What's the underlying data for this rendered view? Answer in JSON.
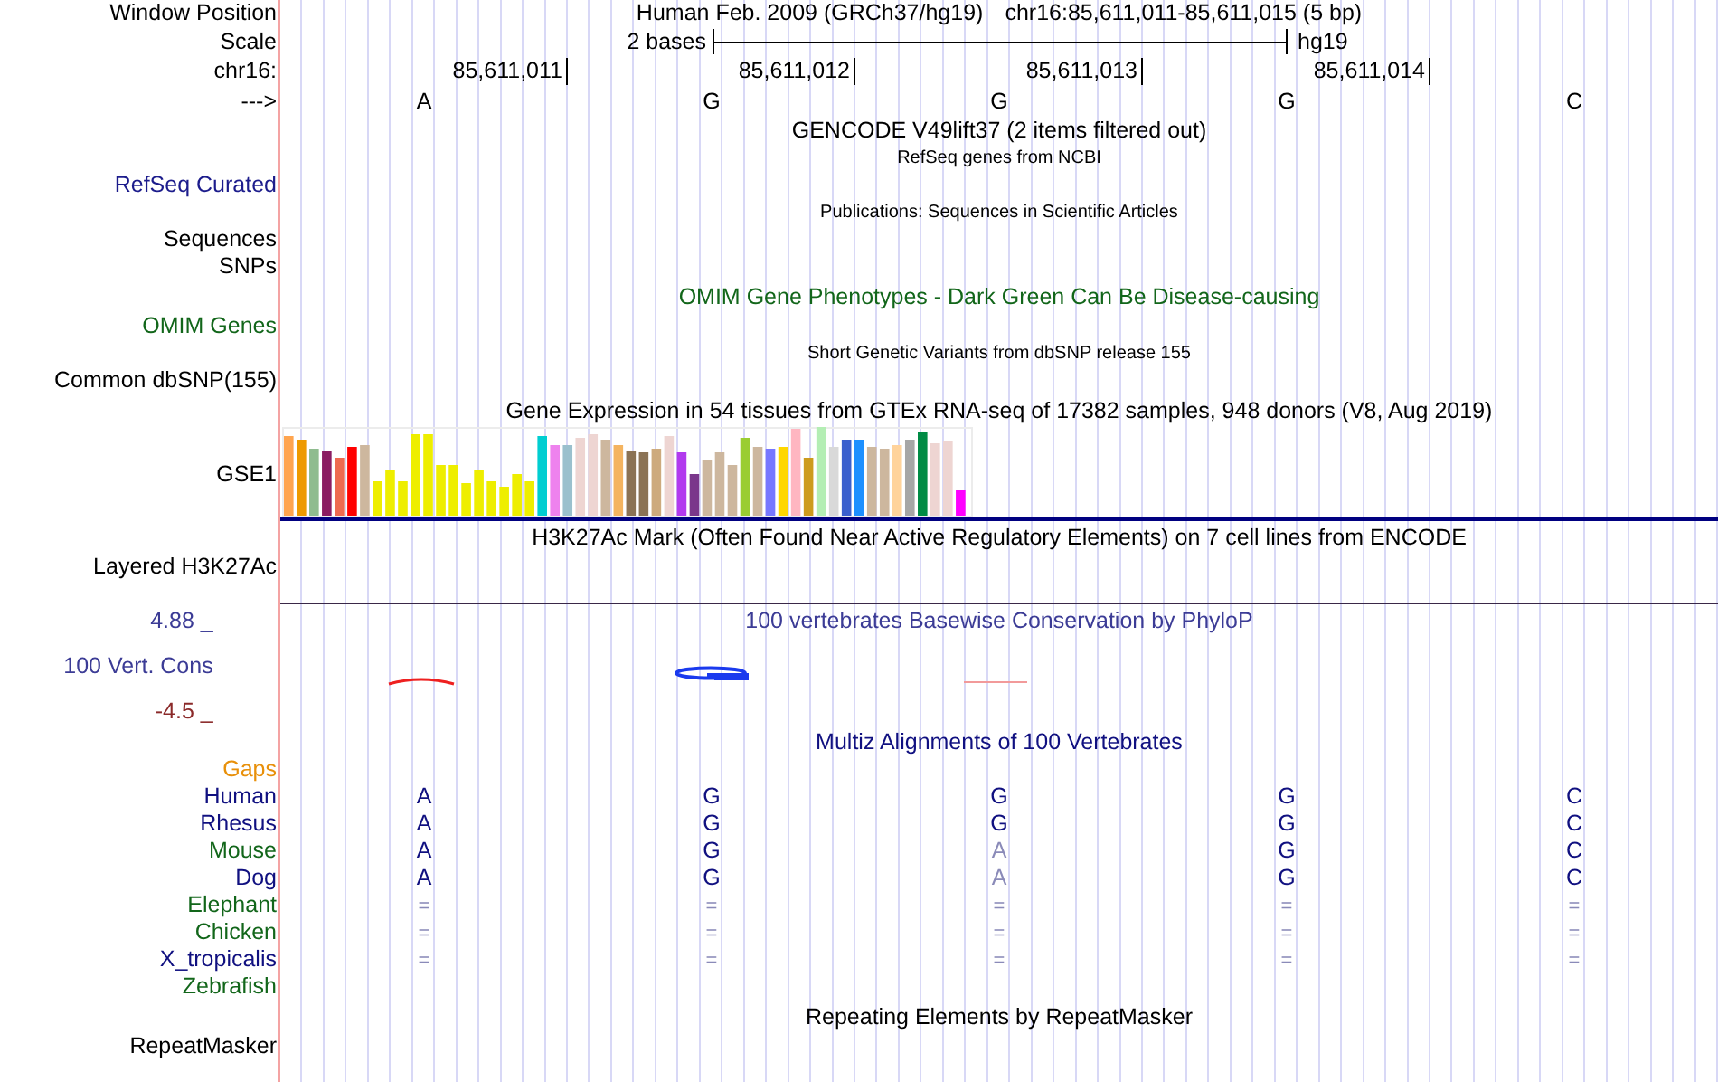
{
  "position": {
    "label": "Window Position",
    "assembly": "Human Feb. 2009 (GRCh37/hg19)",
    "range": "chr16:85,611,011-85,611,015 (5 bp)"
  },
  "scale": {
    "label": "Scale",
    "span": "2 bases",
    "assembly": "hg19"
  },
  "ruler": {
    "label": "chr16:",
    "ticks": [
      "85,611,011",
      "85,611,012",
      "85,611,013",
      "85,611,014"
    ]
  },
  "strand": {
    "label": "--->",
    "bases": [
      "A",
      "G",
      "G",
      "G",
      "C"
    ]
  },
  "tracks": [
    {
      "kind": "title_only",
      "title": "GENCODE V49lift37 (2 items filtered out)",
      "color": "#000000"
    },
    {
      "kind": "subtrack",
      "title": "RefSeq genes from NCBI",
      "labels": [
        "RefSeq Curated"
      ],
      "color": "#1c1c8c"
    },
    {
      "kind": "subtrack",
      "title": "Publications: Sequences in Scientific Articles",
      "labels": [
        "Sequences",
        "SNPs"
      ],
      "color": "#000000"
    },
    {
      "kind": "track",
      "title": "OMIM Gene Phenotypes - Dark Green Can Be Disease-causing",
      "labels": [
        "OMIM Genes"
      ],
      "color": "#12661a"
    },
    {
      "kind": "subtrack",
      "title": "Short Genetic Variants from dbSNP release 155",
      "labels": [
        "Common dbSNP(155)"
      ],
      "color": "#000000"
    },
    {
      "kind": "bar_graph",
      "title": "Gene Expression in 54 tissues from GTEx RNA-seq of 17382 samples, 948 donors (V8, Aug 2019)",
      "labels": [
        "GSE1"
      ],
      "color": "#000000"
    },
    {
      "kind": "signal",
      "title": "H3K27Ac Mark (Often Found Near Active Regulatory Elements) on 7 cell lines from ENCODE",
      "labels": [
        "Layered H3K27Ac"
      ],
      "color": "#000000"
    },
    {
      "kind": "wiggle",
      "title": "100 vertebrates Basewise Conservation by PhyloP",
      "labels": [
        "100 Vert. Cons"
      ],
      "max_label": "4.88 _",
      "min_label": "-4.5 _",
      "color": "#3c3c96"
    },
    {
      "kind": "alignment",
      "title": "Multiz Alignments of 100 Vertebrates",
      "gaps_label": "Gaps",
      "color": "#101080",
      "species": [
        {
          "name": "Human",
          "color": "#101080",
          "bases": [
            {
              "text": "A",
              "kind": "match"
            },
            {
              "text": "G",
              "kind": "match"
            },
            {
              "text": "G",
              "kind": "match"
            },
            {
              "text": "G",
              "kind": "match"
            },
            {
              "text": "C",
              "kind": "match"
            }
          ]
        },
        {
          "name": "Rhesus",
          "color": "#101080",
          "bases": [
            {
              "text": "A",
              "kind": "match"
            },
            {
              "text": "G",
              "kind": "match"
            },
            {
              "text": "G",
              "kind": "match"
            },
            {
              "text": "G",
              "kind": "match"
            },
            {
              "text": "C",
              "kind": "match"
            }
          ]
        },
        {
          "name": "Mouse",
          "color": "#12661a",
          "bases": [
            {
              "text": "A",
              "kind": "match"
            },
            {
              "text": "G",
              "kind": "match"
            },
            {
              "text": "A",
              "kind": "mismatch"
            },
            {
              "text": "G",
              "kind": "match"
            },
            {
              "text": "C",
              "kind": "match"
            }
          ]
        },
        {
          "name": "Dog",
          "color": "#101080",
          "bases": [
            {
              "text": "A",
              "kind": "match"
            },
            {
              "text": "G",
              "kind": "match"
            },
            {
              "text": "A",
              "kind": "mismatch"
            },
            {
              "text": "G",
              "kind": "match"
            },
            {
              "text": "C",
              "kind": "match"
            }
          ]
        },
        {
          "name": "Elephant",
          "color": "#12661a",
          "bases": [
            {
              "text": "=",
              "kind": "unaligned"
            },
            {
              "text": "=",
              "kind": "unaligned"
            },
            {
              "text": "=",
              "kind": "unaligned"
            },
            {
              "text": "=",
              "kind": "unaligned"
            },
            {
              "text": "=",
              "kind": "unaligned"
            }
          ]
        },
        {
          "name": "Chicken",
          "color": "#12661a",
          "bases": [
            {
              "text": "=",
              "kind": "unaligned"
            },
            {
              "text": "=",
              "kind": "unaligned"
            },
            {
              "text": "=",
              "kind": "unaligned"
            },
            {
              "text": "=",
              "kind": "unaligned"
            },
            {
              "text": "=",
              "kind": "unaligned"
            }
          ]
        },
        {
          "name": "X_tropicalis",
          "color": "#101080",
          "bases": [
            {
              "text": "=",
              "kind": "unaligned"
            },
            {
              "text": "=",
              "kind": "unaligned"
            },
            {
              "text": "=",
              "kind": "unaligned"
            },
            {
              "text": "=",
              "kind": "unaligned"
            },
            {
              "text": "=",
              "kind": "unaligned"
            }
          ]
        },
        {
          "name": "Zebrafish",
          "color": "#12661a"
        }
      ]
    },
    {
      "kind": "track",
      "title": "Repeating Elements by RepeatMasker",
      "labels": [
        "RepeatMasker"
      ],
      "color": "#000000"
    }
  ]
}
